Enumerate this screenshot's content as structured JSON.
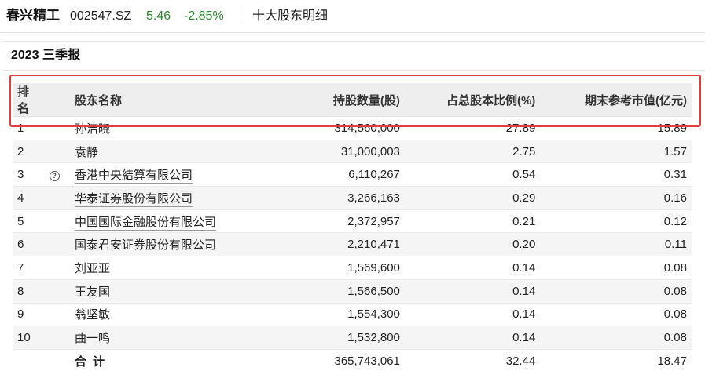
{
  "header": {
    "stock_name": "春兴精工",
    "stock_code": "002547.SZ",
    "price": "5.46",
    "change_pct": "-2.85%",
    "page_title": "十大股东明细",
    "price_color": "#2a8a2a"
  },
  "report": {
    "title": "2023 三季报"
  },
  "table": {
    "columns": [
      "排名",
      "股东名称",
      "持股数量(股)",
      "占总股本比例(%)",
      "期末参考市值(亿元)"
    ],
    "rows": [
      {
        "rank": "1",
        "name": "孙洁晓",
        "shares": "314,560,000",
        "ratio": "27.89",
        "value": "15.89"
      },
      {
        "rank": "2",
        "name": "袁静",
        "shares": "31,000,003",
        "ratio": "2.75",
        "value": "1.57"
      },
      {
        "rank": "3",
        "name": "香港中央結算有限公司",
        "shares": "6,110,267",
        "ratio": "0.54",
        "value": "0.31",
        "icon": "question-circle-icon"
      },
      {
        "rank": "4",
        "name": "华泰证券股份有限公司",
        "shares": "3,266,163",
        "ratio": "0.29",
        "value": "0.16"
      },
      {
        "rank": "5",
        "name": "中国国际金融股份有限公司",
        "shares": "2,372,957",
        "ratio": "0.21",
        "value": "0.12"
      },
      {
        "rank": "6",
        "name": "国泰君安证券股份有限公司",
        "shares": "2,210,471",
        "ratio": "0.20",
        "value": "0.11"
      },
      {
        "rank": "7",
        "name": "刘亚亚",
        "shares": "1,569,600",
        "ratio": "0.14",
        "value": "0.08"
      },
      {
        "rank": "8",
        "name": "王友国",
        "shares": "1,566,500",
        "ratio": "0.14",
        "value": "0.08"
      },
      {
        "rank": "9",
        "name": "翁坚敏",
        "shares": "1,554,300",
        "ratio": "0.14",
        "value": "0.08"
      },
      {
        "rank": "10",
        "name": "曲一鸣",
        "shares": "1,532,800",
        "ratio": "0.14",
        "value": "0.08"
      }
    ],
    "total": {
      "label": "合计",
      "shares": "365,743,061",
      "ratio": "32.44",
      "value": "18.47"
    }
  },
  "highlight_color": "#e23c3c"
}
